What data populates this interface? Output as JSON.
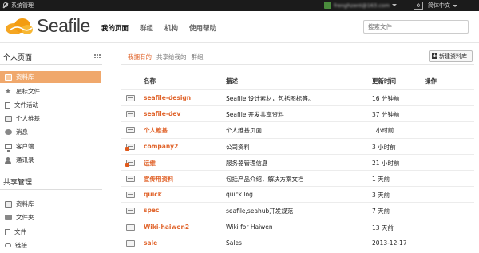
{
  "topbar": {
    "system_label": "系统管理",
    "user_email": "frenghzent@163.com",
    "notice_count": "0",
    "language": "简体中文"
  },
  "header": {
    "logo_text": "Seafile",
    "nav": [
      "我的页面",
      "群组",
      "机构",
      "使用帮助"
    ],
    "search_placeholder": "搜索文件"
  },
  "sidebar": {
    "personal_title": "个人页面",
    "personal_items": [
      {
        "label": "资料库",
        "icon": "library-icon"
      },
      {
        "label": "星标文件",
        "icon": "star-icon"
      },
      {
        "label": "文件活动",
        "icon": "file-activity-icon"
      },
      {
        "label": "个人维基",
        "icon": "wiki-icon"
      },
      {
        "label": "消息",
        "icon": "message-icon"
      },
      {
        "label": "客户端",
        "icon": "client-icon"
      },
      {
        "label": "通讯录",
        "icon": "contacts-icon"
      }
    ],
    "share_title": "共享管理",
    "share_items": [
      {
        "label": "资料库",
        "icon": "library-icon"
      },
      {
        "label": "文件夹",
        "icon": "folder-icon"
      },
      {
        "label": "文件",
        "icon": "file-icon"
      },
      {
        "label": "链接",
        "icon": "link-icon"
      }
    ]
  },
  "main": {
    "tabs": [
      "我拥有的",
      "共享给我的",
      "群组"
    ],
    "new_button": "新建资料库",
    "columns": [
      "名称",
      "描述",
      "更新时间",
      "操作"
    ],
    "rows": [
      {
        "name": "seafile-design",
        "desc": "Seafile 设计素材，包括图标等。",
        "time": "16 分钟前",
        "encrypted": false
      },
      {
        "name": "seafile-dev",
        "desc": "Seafile 开发共享资料",
        "time": "37 分钟前",
        "encrypted": false
      },
      {
        "name": "个人維基",
        "desc": "个人维基页面",
        "time": "1小时前",
        "encrypted": false
      },
      {
        "name": "company2",
        "desc": "公司资料",
        "time": "3 小时前",
        "encrypted": true
      },
      {
        "name": "运维",
        "desc": "服务器管理信息",
        "time": "21 小时前",
        "encrypted": true
      },
      {
        "name": "宣传用资料",
        "desc": "包括产品介绍，解决方案文档",
        "time": "1 天前",
        "encrypted": false
      },
      {
        "name": "quick",
        "desc": "quick log",
        "time": "3 天前",
        "encrypted": false
      },
      {
        "name": "spec",
        "desc": "seafile,seahub开发规范",
        "time": "7 天前",
        "encrypted": false
      },
      {
        "name": "Wiki-haiwen2",
        "desc": "Wiki for Haiwen",
        "time": "13 天前",
        "encrypted": false
      },
      {
        "name": "sale",
        "desc": "Sales",
        "time": "2013-12-17",
        "encrypted": false
      }
    ]
  },
  "colors": {
    "accent": "#e0632a",
    "active_sidebar": "#f0a86c",
    "topbar": "#1b1b1b"
  }
}
